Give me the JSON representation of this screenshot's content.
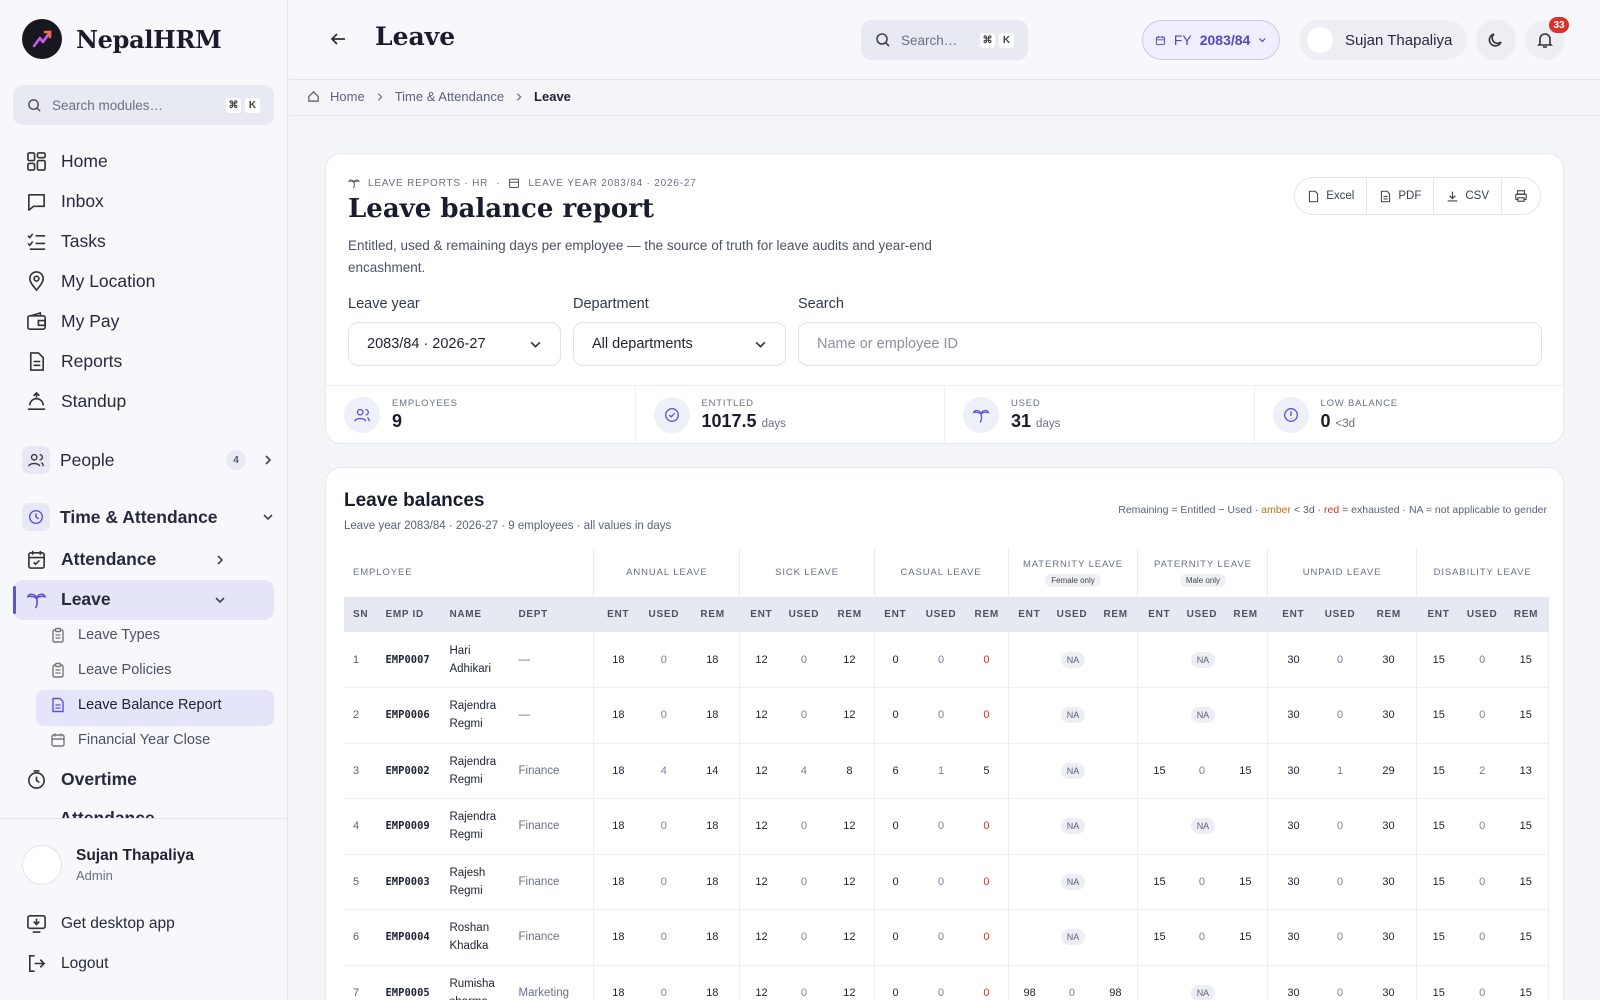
{
  "app": {
    "name": "NepalHRM"
  },
  "sidebar": {
    "search_placeholder": "Search modules…",
    "search_kbd": [
      "⌘",
      "K"
    ],
    "items": {
      "home": "Home",
      "inbox": "Inbox",
      "tasks": "Tasks",
      "location": "My Location",
      "pay": "My Pay",
      "reports": "Reports",
      "standup": "Standup"
    },
    "people": {
      "label": "People",
      "count": "4"
    },
    "time_attendance": "Time & Attendance",
    "attendance": "Attendance",
    "leave": "Leave",
    "leave_sub": {
      "types": "Leave Types",
      "policies": "Leave Policies",
      "balance": "Leave Balance Report",
      "fy_close": "Financial Year Close"
    },
    "overtime": "Overtime",
    "attendance_settings": "Attendance Settings",
    "user": {
      "name": "Sujan Thapaliya",
      "role": "Admin"
    },
    "desktop_app": "Get desktop app",
    "logout": "Logout"
  },
  "topbar": {
    "title": "Leave",
    "search_placeholder": "Search…",
    "search_kbd": [
      "⌘",
      "K"
    ],
    "fy_prefix": "FY",
    "fy_value": "2083/84",
    "user_name": "Sujan Thapaliya",
    "notif_count": "33"
  },
  "breadcrumb": {
    "home": "Home",
    "section": "Time & Attendance",
    "current": "Leave"
  },
  "report": {
    "eyebrow_1": "LEAVE REPORTS · HR",
    "eyebrow_2": "LEAVE YEAR 2083/84 · 2026-27",
    "title": "Leave balance report",
    "description": "Entitled, used & remaining days per employee — the source of truth for leave audits and year-end encashment.",
    "exports": {
      "excel": "Excel",
      "pdf": "PDF",
      "csv": "CSV"
    },
    "filters": {
      "leave_year_label": "Leave year",
      "leave_year_value": "2083/84 · 2026-27",
      "department_label": "Department",
      "department_value": "All departments",
      "search_label": "Search",
      "search_placeholder": "Name or employee ID"
    },
    "stats": {
      "employees": {
        "label": "EMPLOYEES",
        "value": "9"
      },
      "entitled": {
        "label": "ENTITLED",
        "value": "1017.5",
        "unit": "days"
      },
      "used": {
        "label": "USED",
        "value": "31",
        "unit": "days"
      },
      "low": {
        "label": "LOW BALANCE",
        "value": "0",
        "unit": "<3d"
      }
    }
  },
  "balances": {
    "title": "Leave balances",
    "subtitle": "Leave year 2083/84 · 2026-27 · 9 employees · all values in days",
    "legend": {
      "a": "Remaining = Entitled − Used · ",
      "amber": "amber",
      "b": " < 3d · ",
      "red": "red",
      "c": " = exhausted · NA = not applicable to gender"
    },
    "groups": {
      "employee": "EMPLOYEE",
      "annual": "ANNUAL LEAVE",
      "sick": "SICK LEAVE",
      "casual": "CASUAL LEAVE",
      "maternity": "MATERNITY LEAVE",
      "maternity_tag": "Female only",
      "paternity": "PATERNITY LEAVE",
      "paternity_tag": "Male only",
      "unpaid": "UNPAID LEAVE",
      "disability": "DISABILITY LEAVE"
    },
    "columns": {
      "sn": "SN",
      "emp_id": "EMP ID",
      "name": "NAME",
      "dept": "DEPT",
      "ent": "ENT",
      "used": "USED",
      "rem": "REM"
    },
    "na_label": "NA",
    "rows": [
      {
        "sn": "1",
        "id": "EMP0007",
        "name": "Hari Adhikari",
        "dept": "—",
        "annual": [
          "18",
          "0",
          "18"
        ],
        "sick": [
          "12",
          "0",
          "12"
        ],
        "casual": [
          "0",
          "0",
          "0"
        ],
        "maternity": null,
        "paternity": null,
        "unpaid": [
          "30",
          "0",
          "30"
        ],
        "disability": [
          "15",
          "0",
          "15"
        ]
      },
      {
        "sn": "2",
        "id": "EMP0006",
        "name": "Rajendra Regmi",
        "dept": "—",
        "annual": [
          "18",
          "0",
          "18"
        ],
        "sick": [
          "12",
          "0",
          "12"
        ],
        "casual": [
          "0",
          "0",
          "0"
        ],
        "maternity": null,
        "paternity": null,
        "unpaid": [
          "30",
          "0",
          "30"
        ],
        "disability": [
          "15",
          "0",
          "15"
        ]
      },
      {
        "sn": "3",
        "id": "EMP0002",
        "name": "Rajendra Regmi",
        "dept": "Finance",
        "annual": [
          "18",
          "4",
          "14"
        ],
        "sick": [
          "12",
          "4",
          "8"
        ],
        "casual": [
          "6",
          "1",
          "5"
        ],
        "maternity": null,
        "paternity": [
          "15",
          "0",
          "15"
        ],
        "unpaid": [
          "30",
          "1",
          "29"
        ],
        "disability": [
          "15",
          "2",
          "13"
        ]
      },
      {
        "sn": "4",
        "id": "EMP0009",
        "name": "Rajendra Regmi",
        "dept": "Finance",
        "annual": [
          "18",
          "0",
          "18"
        ],
        "sick": [
          "12",
          "0",
          "12"
        ],
        "casual": [
          "0",
          "0",
          "0"
        ],
        "maternity": null,
        "paternity": null,
        "unpaid": [
          "30",
          "0",
          "30"
        ],
        "disability": [
          "15",
          "0",
          "15"
        ]
      },
      {
        "sn": "5",
        "id": "EMP0003",
        "name": "Rajesh Regmi",
        "dept": "Finance",
        "annual": [
          "18",
          "0",
          "18"
        ],
        "sick": [
          "12",
          "0",
          "12"
        ],
        "casual": [
          "0",
          "0",
          "0"
        ],
        "maternity": null,
        "paternity": [
          "15",
          "0",
          "15"
        ],
        "unpaid": [
          "30",
          "0",
          "30"
        ],
        "disability": [
          "15",
          "0",
          "15"
        ]
      },
      {
        "sn": "6",
        "id": "EMP0004",
        "name": "Roshan Khadka",
        "dept": "Finance",
        "annual": [
          "18",
          "0",
          "18"
        ],
        "sick": [
          "12",
          "0",
          "12"
        ],
        "casual": [
          "0",
          "0",
          "0"
        ],
        "maternity": null,
        "paternity": [
          "15",
          "0",
          "15"
        ],
        "unpaid": [
          "30",
          "0",
          "30"
        ],
        "disability": [
          "15",
          "0",
          "15"
        ]
      },
      {
        "sn": "7",
        "id": "EMP0005",
        "name": "Rumisha sharma",
        "dept": "Marketing",
        "annual": [
          "18",
          "0",
          "18"
        ],
        "sick": [
          "12",
          "0",
          "12"
        ],
        "casual": [
          "0",
          "0",
          "0"
        ],
        "maternity": [
          "98",
          "0",
          "98"
        ],
        "paternity": null,
        "unpaid": [
          "30",
          "0",
          "30"
        ],
        "disability": [
          "15",
          "0",
          "15"
        ]
      }
    ]
  },
  "colors": {
    "accent": "#5b54d6",
    "danger": "#d0312b",
    "amber": "#b6740d"
  }
}
